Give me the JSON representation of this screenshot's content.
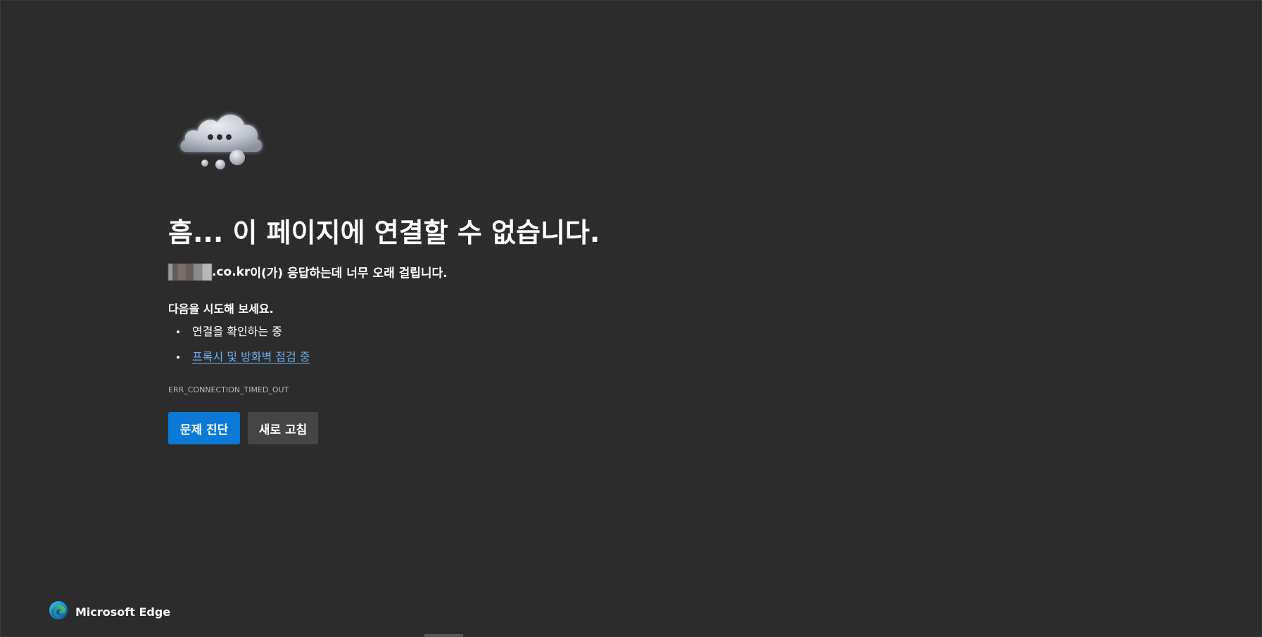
{
  "error_page": {
    "headline": "흠... 이 페이지에 연결할 수 없습니다.",
    "description": {
      "domain_suffix": ".co.kr",
      "message": "이(가) 응답하는데 너무 오래 걸립니다."
    },
    "suggestions": {
      "title": "다음을 시도해 보세요.",
      "items": [
        {
          "label": "연결을 확인하는 중",
          "is_link": false
        },
        {
          "label": "프록시 및 방화벽 점검 중",
          "is_link": true
        }
      ]
    },
    "error_code": "ERR_CONNECTION_TIMED_OUT",
    "buttons": {
      "diagnose_label": "문제 진단",
      "refresh_label": "새로 고침"
    }
  },
  "branding": {
    "name": "Microsoft Edge",
    "logo_icon": "edge-logo-icon"
  },
  "illustration": {
    "icon": "thinking-cloud-icon"
  },
  "colors": {
    "background": "#2c2c2c",
    "primary_button": "#0b79d6",
    "secondary_button": "#454545",
    "link": "#6cb0f0",
    "error_code_text": "#b8b8b8"
  }
}
